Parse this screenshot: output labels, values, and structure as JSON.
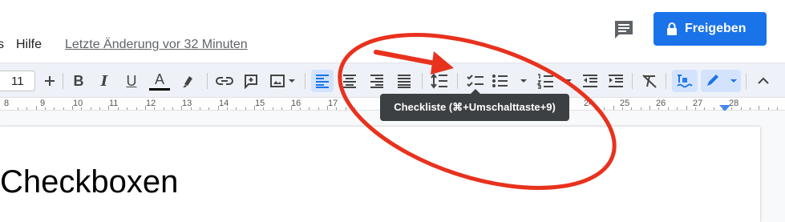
{
  "header": {
    "menu_partial": "s",
    "menu_help": "Hilfe",
    "last_edit": "Letzte Änderung vor 32 Minuten",
    "comment_icon": "comment-icon",
    "share_label": "Freigeben",
    "share_color": "#1a73e8"
  },
  "toolbar": {
    "font_size": "11",
    "buttons": [
      {
        "name": "increase-font-size-button",
        "icon": "plus-icon"
      },
      {
        "name": "bold-button",
        "label": "B"
      },
      {
        "name": "italic-button",
        "label": "I"
      },
      {
        "name": "underline-button",
        "label": "U"
      },
      {
        "name": "text-color-button",
        "label": "A"
      },
      {
        "name": "highlight-button",
        "icon": "highlighter-icon"
      },
      {
        "name": "insert-link-button",
        "icon": "link-icon"
      },
      {
        "name": "add-comment-button",
        "icon": "add-comment-icon"
      },
      {
        "name": "insert-image-button",
        "icon": "image-icon"
      },
      {
        "name": "align-left-button",
        "icon": "align-left-icon",
        "active": true
      },
      {
        "name": "align-center-button",
        "icon": "align-center-icon"
      },
      {
        "name": "align-right-button",
        "icon": "align-right-icon"
      },
      {
        "name": "justify-button",
        "icon": "justify-icon"
      },
      {
        "name": "line-spacing-button",
        "icon": "line-spacing-icon"
      },
      {
        "name": "checklist-button",
        "icon": "checklist-icon"
      },
      {
        "name": "bulleted-list-button",
        "icon": "bulleted-list-icon"
      },
      {
        "name": "numbered-list-button",
        "icon": "numbered-list-icon"
      },
      {
        "name": "decrease-indent-button",
        "icon": "decrease-indent-icon"
      },
      {
        "name": "increase-indent-button",
        "icon": "increase-indent-icon"
      },
      {
        "name": "clear-formatting-button",
        "icon": "clear-formatting-icon"
      },
      {
        "name": "spellcheck-button",
        "icon": "spellcheck-icon",
        "active": true
      },
      {
        "name": "editing-mode-button",
        "icon": "pencil-icon",
        "active": true
      },
      {
        "name": "collapse-menus-button",
        "icon": "chevron-up-icon"
      }
    ]
  },
  "ruler": {
    "numbers": [
      "8",
      "9",
      "10",
      "11",
      "12",
      "13",
      "14",
      "15",
      "16",
      "17",
      "24",
      "25",
      "26",
      "27",
      "28"
    ]
  },
  "tooltip": {
    "text": "Checkliste (⌘+Umschalttaste+9)"
  },
  "document": {
    "heading": "Checkboxen"
  },
  "annotation": {
    "color": "#e8321e"
  }
}
